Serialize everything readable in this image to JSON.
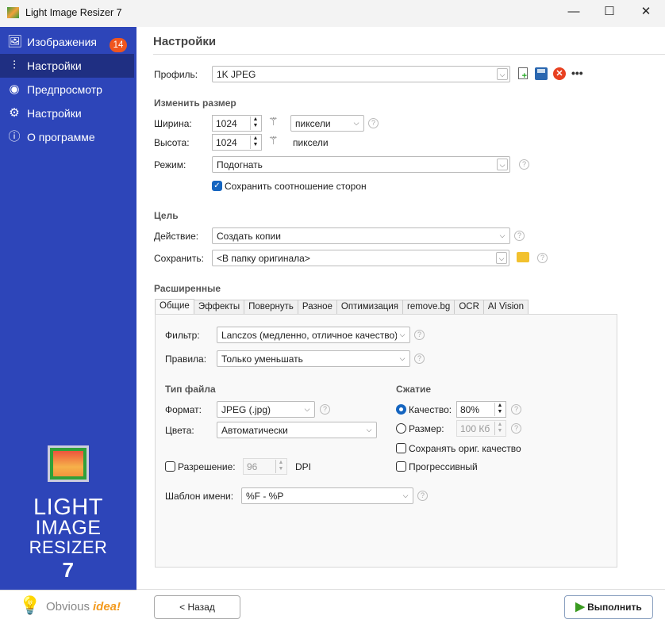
{
  "window": {
    "title": "Light Image Resizer 7",
    "minimize": "—",
    "maximize": "☐",
    "close": "✕"
  },
  "sidebar": {
    "items": [
      {
        "label": "Изображения",
        "icon": "images-icon",
        "badge": "14"
      },
      {
        "label": "Настройки",
        "icon": "sliders-icon"
      },
      {
        "label": "Предпросмотр",
        "icon": "eye-icon"
      },
      {
        "label": "Настройки",
        "icon": "gear-icon"
      },
      {
        "label": "О программе",
        "icon": "info-icon"
      }
    ],
    "logo": {
      "line1": "LIGHT",
      "line2": "IMAGE",
      "line3": "RESIZER",
      "line4": "7"
    },
    "brand": {
      "part1": "Obvious",
      "part2": "idea!"
    }
  },
  "header": {
    "title": "Настройки"
  },
  "profile": {
    "label": "Профиль:",
    "value": "1K JPEG"
  },
  "resize": {
    "title": "Изменить размер",
    "width_label": "Ширина:",
    "width": "1024",
    "height_label": "Высота:",
    "height": "1024",
    "unit": "пиксели",
    "unit2": "пиксели",
    "mode_label": "Режим:",
    "mode": "Подогнать",
    "keep_ratio": "Сохранить соотношение сторон",
    "keep_ratio_checked": true
  },
  "target": {
    "title": "Цель",
    "action_label": "Действие:",
    "action": "Создать копии",
    "save_label": "Сохранить:",
    "save": "<В папку оригинала>"
  },
  "advanced": {
    "title": "Расширенные",
    "tabs": [
      "Общие",
      "Эффекты",
      "Повернуть",
      "Разное",
      "Оптимизация",
      "remove.bg",
      "OCR",
      "AI Vision"
    ],
    "filter_label": "Фильтр:",
    "filter": "Lanczos  (медленно, отличное качество)",
    "rules_label": "Правила:",
    "rules": "Только уменьшать",
    "filetype_title": "Тип файла",
    "format_label": "Формат:",
    "format": "JPEG (.jpg)",
    "colors_label": "Цвета:",
    "colors": "Автоматически",
    "resolution_label": "Разрешение:",
    "resolution": "96",
    "dpi": "DPI",
    "name_template_label": "Шаблон имени:",
    "name_template": "%F - %P",
    "compression_title": "Сжатие",
    "quality_label": "Качество:",
    "quality": "80%",
    "size_label": "Размер:",
    "size": "100 Кб",
    "keep_quality": "Сохранять ориг. качество",
    "progressive": "Прогрессивный"
  },
  "footer": {
    "back": "< Назад",
    "run": "Выполнить"
  },
  "colors": {
    "sidebar": "#2d45b9",
    "selected": "#1f2f82",
    "badge": "#f0551e",
    "accent": "#1565c0"
  }
}
